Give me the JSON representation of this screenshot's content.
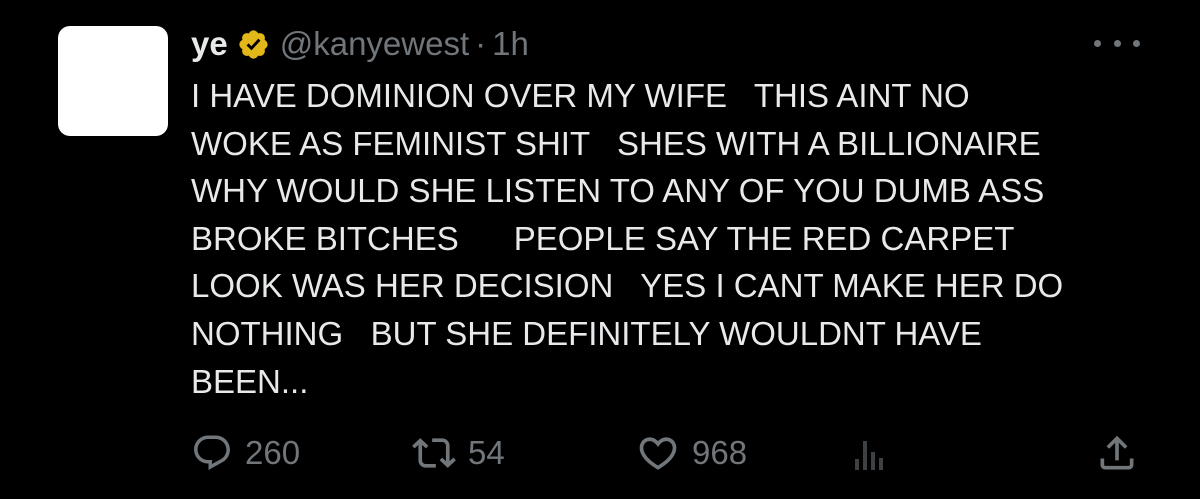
{
  "tweet": {
    "display_name": "ye",
    "handle": "@kanyewest",
    "separator": "·",
    "time": "1h",
    "text": "I HAVE DOMINION OVER MY WIFE   THIS AINT NO\nWOKE AS FEMINIST SHIT   SHES WITH A BILLIONAIRE\nWHY WOULD SHE LISTEN TO ANY OF YOU DUMB ASS\nBROKE BITCHES      PEOPLE SAY THE RED CARPET\nLOOK WAS HER DECISION   YES I CANT MAKE HER DO\nNOTHING   BUT SHE DEFINITELY WOULDNT HAVE\nBEEN...",
    "verified_badge_color": "#e2b719"
  },
  "actions": {
    "reply_count": "260",
    "retweet_count": "54",
    "like_count": "968"
  },
  "icons": {
    "avatar": "avatar-placeholder",
    "verified": "verified-badge-icon",
    "more": "more-icon",
    "reply": "reply-icon",
    "retweet": "retweet-icon",
    "like": "heart-icon",
    "views": "views-icon",
    "share": "share-icon"
  },
  "colors": {
    "background": "#000000",
    "text": "#e7e9ea",
    "muted": "#71767b",
    "views_icon": "#3e4144"
  }
}
